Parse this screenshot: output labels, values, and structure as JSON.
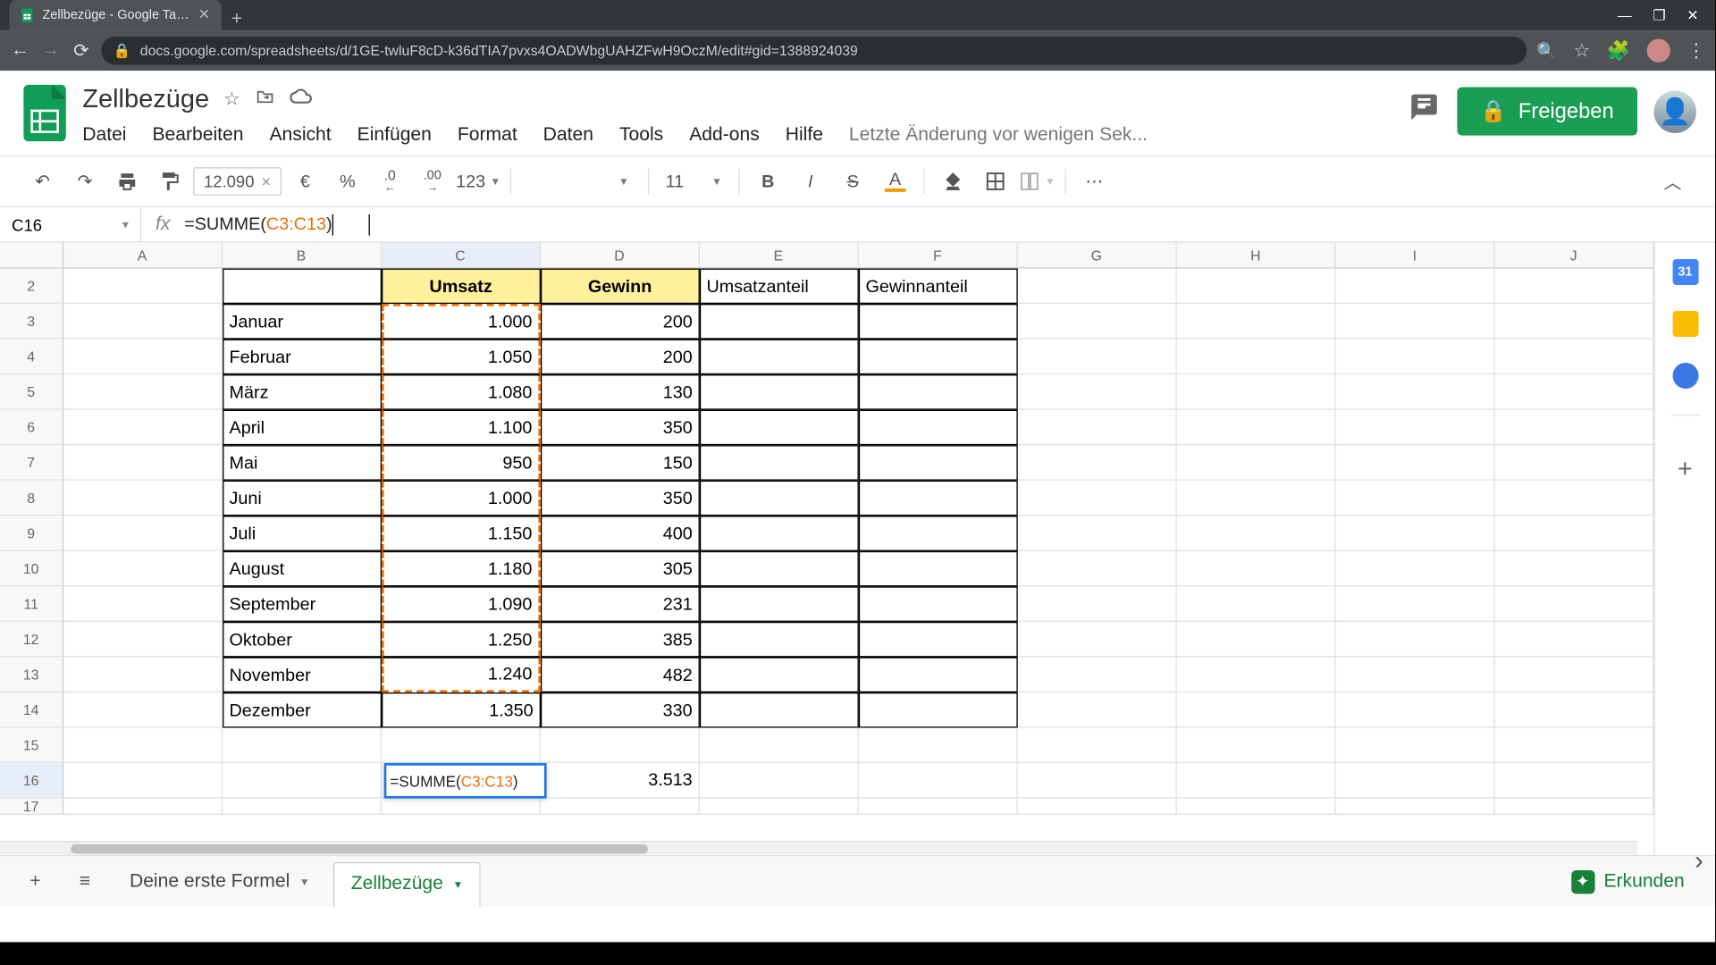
{
  "browser": {
    "tab_title": "Zellbezüge - Google Tabellen",
    "url": "docs.google.com/spreadsheets/d/1GE-twluF8cD-k36dTIA7pvxs4OADWbgUAHZFwH9OczM/edit#gid=1388924039"
  },
  "doc": {
    "title": "Zellbezüge",
    "last_mod": "Letzte Änderung vor wenigen Sek...",
    "share": "Freigeben"
  },
  "menu": {
    "file": "Datei",
    "edit": "Bearbeiten",
    "view": "Ansicht",
    "insert": "Einfügen",
    "format": "Format",
    "data": "Daten",
    "tools": "Tools",
    "addons": "Add-ons",
    "help": "Hilfe"
  },
  "toolbar": {
    "preview": "12.090",
    "currency": "€",
    "percent": "%",
    "dec_dec": ".0",
    "inc_dec": ".00",
    "fmt123": "123",
    "font_size": "11"
  },
  "fbar": {
    "name": "C16",
    "formula_pre": "=SUMME(",
    "formula_range": "C3:C13",
    "formula_post": ")"
  },
  "columns": [
    "A",
    "B",
    "C",
    "D",
    "E",
    "F",
    "G",
    "H",
    "I",
    "J"
  ],
  "row_nums": [
    2,
    3,
    4,
    5,
    6,
    7,
    8,
    9,
    10,
    11,
    12,
    13,
    14,
    15,
    16,
    17
  ],
  "headers": {
    "umsatz": "Umsatz",
    "gewinn": "Gewinn",
    "uanteil": "Umsatzanteil",
    "ganteil": "Gewinnanteil"
  },
  "months": [
    "Januar",
    "Februar",
    "März",
    "April",
    "Mai",
    "Juni",
    "Juli",
    "August",
    "September",
    "Oktober",
    "November",
    "Dezember"
  ],
  "umsatz": [
    "1.000",
    "1.050",
    "1.080",
    "1.100",
    "950",
    "1.000",
    "1.150",
    "1.180",
    "1.090",
    "1.250",
    "1.240",
    "1.350"
  ],
  "gewinn": [
    "200",
    "200",
    "130",
    "350",
    "150",
    "350",
    "400",
    "305",
    "231",
    "385",
    "482",
    "330"
  ],
  "c16_formula": "=SUMME(C3:C13)",
  "d16": "3.513",
  "sheets": {
    "first": "Deine erste Formel",
    "active": "Zellbezüge",
    "explore": "Erkunden"
  }
}
